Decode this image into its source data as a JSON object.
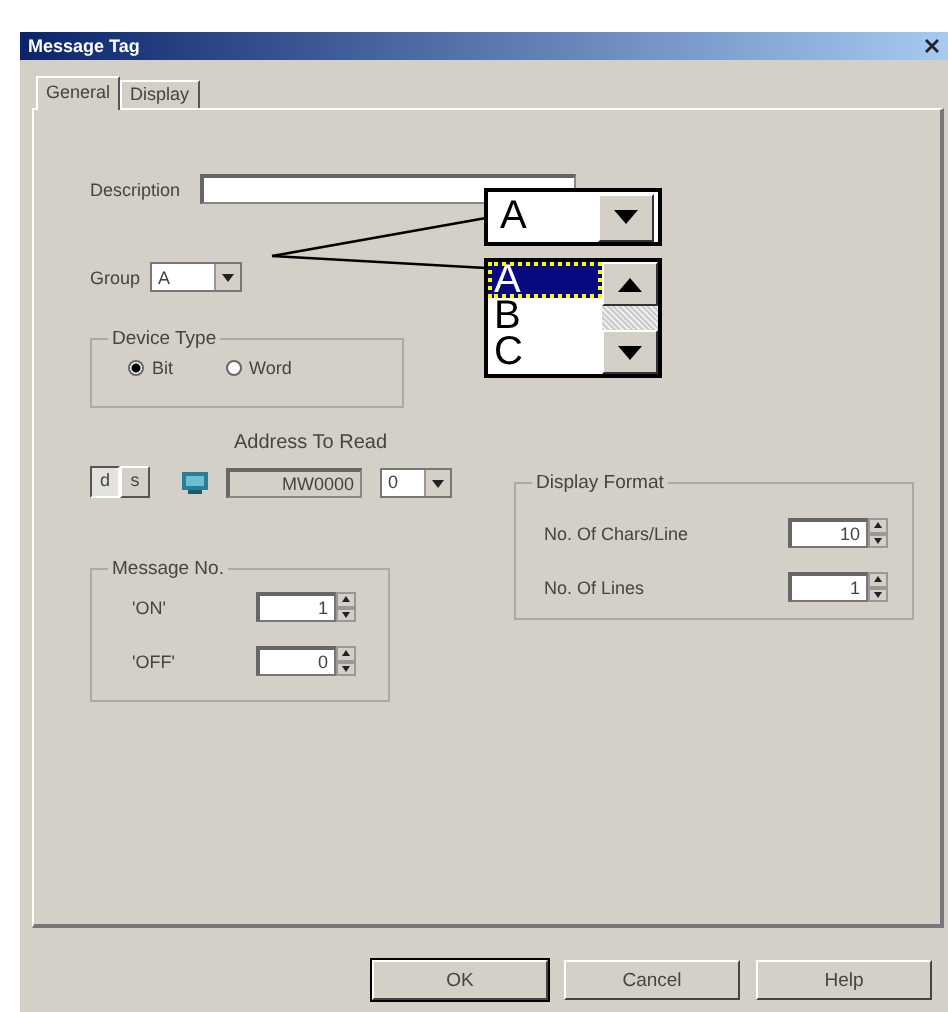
{
  "window": {
    "title": "Message Tag"
  },
  "tabs": [
    {
      "label": "General",
      "selected": true
    },
    {
      "label": "Display",
      "selected": false
    }
  ],
  "description": {
    "label": "Description"
  },
  "group": {
    "label": "Group",
    "value": "A"
  },
  "device_type": {
    "title": "Device Type",
    "options": [
      {
        "label": "Bit",
        "selected": true
      },
      {
        "label": "Word",
        "selected": false
      }
    ]
  },
  "address": {
    "label": "Address To Read",
    "buttons": [
      {
        "label": "d",
        "selected": true
      },
      {
        "label": "s",
        "selected": false
      }
    ],
    "value": "MW0000",
    "index": "0"
  },
  "message_no": {
    "title": "Message No.",
    "rows": [
      {
        "label": "'ON'",
        "value": "1"
      },
      {
        "label": "'OFF'",
        "value": "0"
      }
    ]
  },
  "display_format": {
    "title": "Display Format",
    "rows": [
      {
        "label": "No. Of Chars/Line",
        "value": "10"
      },
      {
        "label": "No. Of Lines",
        "value": "1"
      }
    ]
  },
  "zoom_callout": {
    "value": "A",
    "items": [
      {
        "label": "A",
        "selected": true
      },
      {
        "label": "B",
        "selected": false
      },
      {
        "label": "C",
        "selected": false
      }
    ]
  },
  "buttons": [
    "OK",
    "Cancel",
    "Help"
  ]
}
